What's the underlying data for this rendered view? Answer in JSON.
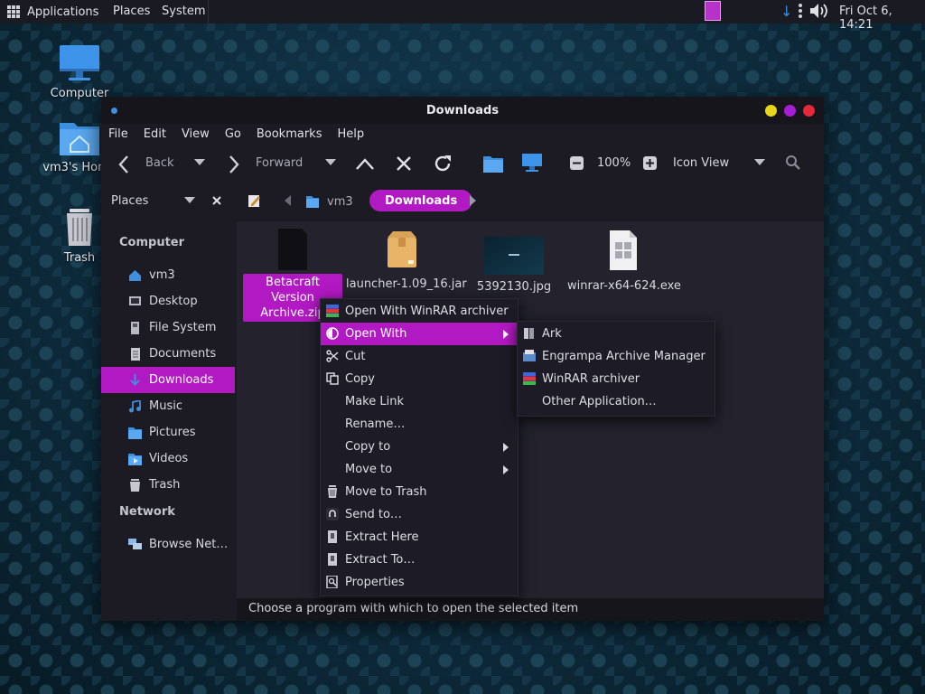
{
  "top_panel": {
    "applications": "Applications",
    "places": "Places",
    "system": "System",
    "clock": "Fri Oct  6, 14:21"
  },
  "desktop": {
    "icons": [
      {
        "label": "Computer"
      },
      {
        "label": "vm3's Home"
      },
      {
        "label": "Trash"
      }
    ]
  },
  "window": {
    "title": "Downloads",
    "menus": [
      "File",
      "Edit",
      "View",
      "Go",
      "Bookmarks",
      "Help"
    ],
    "toolbar": {
      "back": "Back",
      "forward": "Forward",
      "zoom": "100%",
      "view_mode": "Icon View"
    },
    "location": {
      "places_label": "Places",
      "crumbs": [
        "vm3",
        "Downloads"
      ]
    },
    "sidebar": {
      "computer_heading": "Computer",
      "computer_items": [
        "vm3",
        "Desktop",
        "File System",
        "Documents",
        "Downloads",
        "Music",
        "Pictures",
        "Videos",
        "Trash"
      ],
      "network_heading": "Network",
      "network_items": [
        "Browse Net…"
      ]
    },
    "files": [
      {
        "name": "Betacraft Version Archive.zip",
        "line1": "Betacraft Version",
        "line2": "Archive.zip",
        "selected": true
      },
      {
        "name": "launcher-1.09_16.jar"
      },
      {
        "name": "5392130.jpg"
      },
      {
        "name": "winrar-x64-624.exe"
      }
    ],
    "status": "Choose a program with which to open the selected item"
  },
  "context_menu": {
    "items": [
      "Open With WinRAR archiver",
      "Open With",
      "Cut",
      "Copy",
      "Make Link",
      "Rename…",
      "Copy to",
      "Move to",
      "Move to Trash",
      "Send to…",
      "Extract Here",
      "Extract To…",
      "Properties"
    ]
  },
  "submenu": {
    "items": [
      "Ark",
      "Engrampa Archive Manager",
      "WinRAR archiver",
      "Other Application…"
    ]
  },
  "colors": {
    "accent": "#b119c2",
    "panel": "#1a1a22",
    "window": "#1c1b24",
    "content": "#23222d",
    "folder_blue": "#3d8fe0"
  }
}
